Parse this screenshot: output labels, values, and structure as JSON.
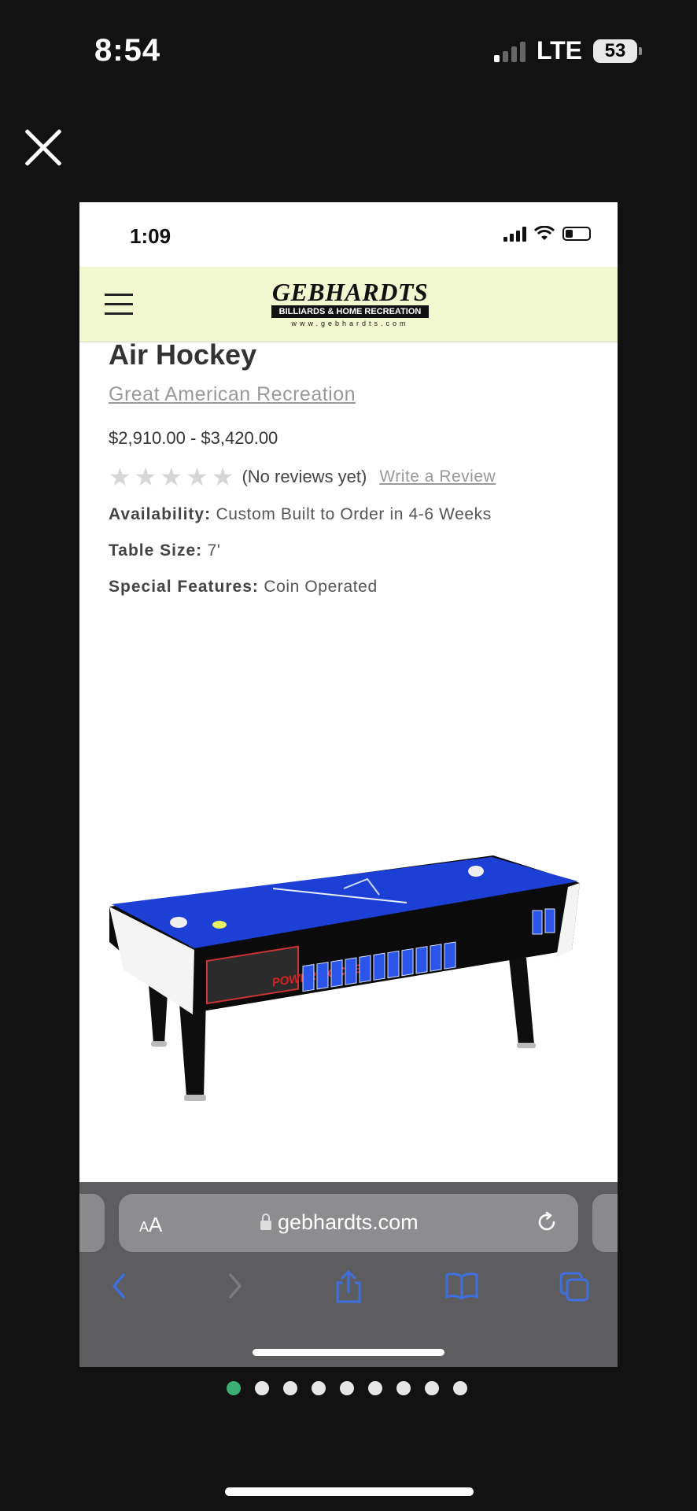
{
  "phone_status": {
    "time": "8:54",
    "network": "LTE",
    "battery": "53"
  },
  "inner_status": {
    "time": "1:09"
  },
  "site": {
    "logo_main": "GEBHARDTS",
    "logo_sub": "BILLIARDS & HOME RECREATION",
    "logo_url": "www.gebhardts.com"
  },
  "product": {
    "title": "Air Hockey",
    "brand": "Great American Recreation",
    "price": "$2,910.00 - $3,420.00",
    "rating_stars": 0,
    "reviews_text": "(No reviews yet)",
    "write_review": "Write a Review",
    "specs": [
      {
        "label": "Availability:",
        "value": "Custom Built to Order in 4-6 Weeks"
      },
      {
        "label": "Table Size:",
        "value": "7'"
      },
      {
        "label": "Special Features:",
        "value": "Coin Operated"
      }
    ],
    "image_label": "POWER HOCKEY"
  },
  "browser": {
    "aa_big": "A",
    "aa_small": "A",
    "url": "gebhardts.com",
    "icons": [
      "back-icon",
      "forward-icon",
      "share-icon",
      "bookmarks-icon",
      "tabs-icon"
    ]
  },
  "gallery": {
    "count": 9,
    "active_index": 0
  },
  "colors": {
    "header_bg": "#f1f8d0",
    "table_blue": "#1c3fd6",
    "active_dot": "#3bae74"
  }
}
